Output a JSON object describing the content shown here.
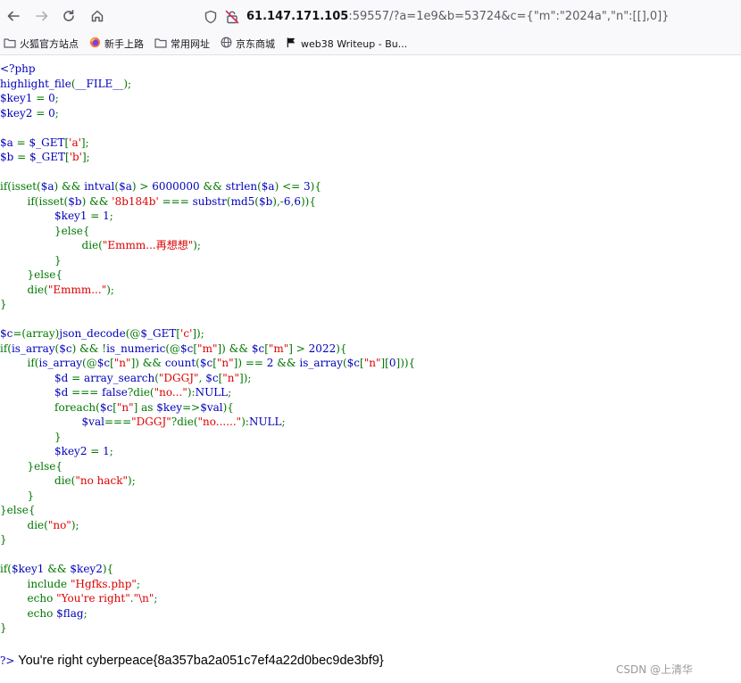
{
  "browser": {
    "url_host": "61.147.171.105",
    "url_rest": ":59557/?a=1e9&b=53724&c={\"m\":\"2024a\",\"n\":[[],0]}",
    "bookmarks": [
      {
        "label": "火狐官方站点",
        "icon": "folder-icon"
      },
      {
        "label": "新手上路",
        "icon": "firefox-icon"
      },
      {
        "label": "常用网址",
        "icon": "folder-icon"
      },
      {
        "label": "京东商城",
        "icon": "globe-icon"
      },
      {
        "label": "web38 Writeup - Bu...",
        "icon": "flag-icon"
      }
    ]
  },
  "code_lines": [
    [
      {
        "c": "df",
        "t": "<?php"
      }
    ],
    [
      {
        "c": "df",
        "t": "highlight_file"
      },
      {
        "c": "kw",
        "t": "("
      },
      {
        "c": "df",
        "t": "__FILE__"
      },
      {
        "c": "kw",
        "t": ");"
      }
    ],
    [
      {
        "c": "df",
        "t": "$key1 "
      },
      {
        "c": "kw",
        "t": "= "
      },
      {
        "c": "df",
        "t": "0"
      },
      {
        "c": "kw",
        "t": ";"
      }
    ],
    [
      {
        "c": "df",
        "t": "$key2 "
      },
      {
        "c": "kw",
        "t": "= "
      },
      {
        "c": "df",
        "t": "0"
      },
      {
        "c": "kw",
        "t": ";"
      }
    ],
    [],
    [
      {
        "c": "df",
        "t": "$a "
      },
      {
        "c": "kw",
        "t": "= "
      },
      {
        "c": "df",
        "t": "$_GET"
      },
      {
        "c": "kw",
        "t": "["
      },
      {
        "c": "st",
        "t": "'a'"
      },
      {
        "c": "kw",
        "t": "];"
      }
    ],
    [
      {
        "c": "df",
        "t": "$b "
      },
      {
        "c": "kw",
        "t": "= "
      },
      {
        "c": "df",
        "t": "$_GET"
      },
      {
        "c": "kw",
        "t": "["
      },
      {
        "c": "st",
        "t": "'b'"
      },
      {
        "c": "kw",
        "t": "];"
      }
    ],
    [],
    [
      {
        "c": "kw",
        "t": "if(isset("
      },
      {
        "c": "df",
        "t": "$a"
      },
      {
        "c": "kw",
        "t": ") && "
      },
      {
        "c": "df",
        "t": "intval"
      },
      {
        "c": "kw",
        "t": "("
      },
      {
        "c": "df",
        "t": "$a"
      },
      {
        "c": "kw",
        "t": ") > "
      },
      {
        "c": "df",
        "t": "6000000 "
      },
      {
        "c": "kw",
        "t": "&& "
      },
      {
        "c": "df",
        "t": "strlen"
      },
      {
        "c": "kw",
        "t": "("
      },
      {
        "c": "df",
        "t": "$a"
      },
      {
        "c": "kw",
        "t": ") <= "
      },
      {
        "c": "df",
        "t": "3"
      },
      {
        "c": "kw",
        "t": "){"
      }
    ],
    [
      {
        "c": "kw",
        "t": "        if(isset("
      },
      {
        "c": "df",
        "t": "$b"
      },
      {
        "c": "kw",
        "t": ") && "
      },
      {
        "c": "st",
        "t": "'8b184b' "
      },
      {
        "c": "kw",
        "t": "=== "
      },
      {
        "c": "df",
        "t": "substr"
      },
      {
        "c": "kw",
        "t": "("
      },
      {
        "c": "df",
        "t": "md5"
      },
      {
        "c": "kw",
        "t": "("
      },
      {
        "c": "df",
        "t": "$b"
      },
      {
        "c": "kw",
        "t": "),-"
      },
      {
        "c": "df",
        "t": "6"
      },
      {
        "c": "kw",
        "t": ","
      },
      {
        "c": "df",
        "t": "6"
      },
      {
        "c": "kw",
        "t": ")){"
      }
    ],
    [
      {
        "c": "df",
        "t": "                $key1 "
      },
      {
        "c": "kw",
        "t": "= "
      },
      {
        "c": "df",
        "t": "1"
      },
      {
        "c": "kw",
        "t": ";"
      }
    ],
    [
      {
        "c": "kw",
        "t": "                }else{"
      }
    ],
    [
      {
        "c": "kw",
        "t": "                        die("
      },
      {
        "c": "st",
        "t": "\"Emmm...再想想\""
      },
      {
        "c": "kw",
        "t": ");"
      }
    ],
    [
      {
        "c": "kw",
        "t": "                }"
      }
    ],
    [
      {
        "c": "kw",
        "t": "        }else{"
      }
    ],
    [
      {
        "c": "kw",
        "t": "        die("
      },
      {
        "c": "st",
        "t": "\"Emmm...\""
      },
      {
        "c": "kw",
        "t": ");"
      }
    ],
    [
      {
        "c": "kw",
        "t": "}"
      }
    ],
    [],
    [
      {
        "c": "df",
        "t": "$c"
      },
      {
        "c": "kw",
        "t": "=(array)"
      },
      {
        "c": "df",
        "t": "json_decode"
      },
      {
        "c": "kw",
        "t": "(@"
      },
      {
        "c": "df",
        "t": "$_GET"
      },
      {
        "c": "kw",
        "t": "["
      },
      {
        "c": "st",
        "t": "'c'"
      },
      {
        "c": "kw",
        "t": "]);"
      }
    ],
    [
      {
        "c": "kw",
        "t": "if("
      },
      {
        "c": "df",
        "t": "is_array"
      },
      {
        "c": "kw",
        "t": "("
      },
      {
        "c": "df",
        "t": "$c"
      },
      {
        "c": "kw",
        "t": ") && !"
      },
      {
        "c": "df",
        "t": "is_numeric"
      },
      {
        "c": "kw",
        "t": "(@"
      },
      {
        "c": "df",
        "t": "$c"
      },
      {
        "c": "kw",
        "t": "["
      },
      {
        "c": "st",
        "t": "\"m\""
      },
      {
        "c": "kw",
        "t": "]) && "
      },
      {
        "c": "df",
        "t": "$c"
      },
      {
        "c": "kw",
        "t": "["
      },
      {
        "c": "st",
        "t": "\"m\""
      },
      {
        "c": "kw",
        "t": "] > "
      },
      {
        "c": "df",
        "t": "2022"
      },
      {
        "c": "kw",
        "t": "){"
      }
    ],
    [
      {
        "c": "kw",
        "t": "        if("
      },
      {
        "c": "df",
        "t": "is_array"
      },
      {
        "c": "kw",
        "t": "(@"
      },
      {
        "c": "df",
        "t": "$c"
      },
      {
        "c": "kw",
        "t": "["
      },
      {
        "c": "st",
        "t": "\"n\""
      },
      {
        "c": "kw",
        "t": "]) && "
      },
      {
        "c": "df",
        "t": "count"
      },
      {
        "c": "kw",
        "t": "("
      },
      {
        "c": "df",
        "t": "$c"
      },
      {
        "c": "kw",
        "t": "["
      },
      {
        "c": "st",
        "t": "\"n\""
      },
      {
        "c": "kw",
        "t": "]) == "
      },
      {
        "c": "df",
        "t": "2 "
      },
      {
        "c": "kw",
        "t": "&& "
      },
      {
        "c": "df",
        "t": "is_array"
      },
      {
        "c": "kw",
        "t": "("
      },
      {
        "c": "df",
        "t": "$c"
      },
      {
        "c": "kw",
        "t": "["
      },
      {
        "c": "st",
        "t": "\"n\""
      },
      {
        "c": "kw",
        "t": "]["
      },
      {
        "c": "df",
        "t": "0"
      },
      {
        "c": "kw",
        "t": "])){"
      }
    ],
    [
      {
        "c": "df",
        "t": "                $d "
      },
      {
        "c": "kw",
        "t": "= "
      },
      {
        "c": "df",
        "t": "array_search"
      },
      {
        "c": "kw",
        "t": "("
      },
      {
        "c": "st",
        "t": "\"DGGJ\""
      },
      {
        "c": "kw",
        "t": ", "
      },
      {
        "c": "df",
        "t": "$c"
      },
      {
        "c": "kw",
        "t": "["
      },
      {
        "c": "st",
        "t": "\"n\""
      },
      {
        "c": "kw",
        "t": "]);"
      }
    ],
    [
      {
        "c": "df",
        "t": "                $d "
      },
      {
        "c": "kw",
        "t": "=== "
      },
      {
        "c": "df",
        "t": "false"
      },
      {
        "c": "kw",
        "t": "?die("
      },
      {
        "c": "st",
        "t": "\"no...\""
      },
      {
        "c": "kw",
        "t": "):"
      },
      {
        "c": "df",
        "t": "NULL"
      },
      {
        "c": "kw",
        "t": ";"
      }
    ],
    [
      {
        "c": "kw",
        "t": "                foreach("
      },
      {
        "c": "df",
        "t": "$c"
      },
      {
        "c": "kw",
        "t": "["
      },
      {
        "c": "st",
        "t": "\"n\""
      },
      {
        "c": "kw",
        "t": "] as "
      },
      {
        "c": "df",
        "t": "$key"
      },
      {
        "c": "kw",
        "t": "=>"
      },
      {
        "c": "df",
        "t": "$val"
      },
      {
        "c": "kw",
        "t": "){"
      }
    ],
    [
      {
        "c": "df",
        "t": "                        $val"
      },
      {
        "c": "kw",
        "t": "==="
      },
      {
        "c": "st",
        "t": "\"DGGJ\""
      },
      {
        "c": "kw",
        "t": "?die("
      },
      {
        "c": "st",
        "t": "\"no......\""
      },
      {
        "c": "kw",
        "t": "):"
      },
      {
        "c": "df",
        "t": "NULL"
      },
      {
        "c": "kw",
        "t": ";"
      }
    ],
    [
      {
        "c": "kw",
        "t": "                }"
      }
    ],
    [
      {
        "c": "df",
        "t": "                $key2 "
      },
      {
        "c": "kw",
        "t": "= "
      },
      {
        "c": "df",
        "t": "1"
      },
      {
        "c": "kw",
        "t": ";"
      }
    ],
    [
      {
        "c": "kw",
        "t": "        }else{"
      }
    ],
    [
      {
        "c": "kw",
        "t": "                die("
      },
      {
        "c": "st",
        "t": "\"no hack\""
      },
      {
        "c": "kw",
        "t": ");"
      }
    ],
    [
      {
        "c": "kw",
        "t": "        }"
      }
    ],
    [
      {
        "c": "kw",
        "t": "}else{"
      }
    ],
    [
      {
        "c": "kw",
        "t": "        die("
      },
      {
        "c": "st",
        "t": "\"no\""
      },
      {
        "c": "kw",
        "t": ");"
      }
    ],
    [
      {
        "c": "kw",
        "t": "}"
      }
    ],
    [],
    [
      {
        "c": "kw",
        "t": "if("
      },
      {
        "c": "df",
        "t": "$key1 "
      },
      {
        "c": "kw",
        "t": "&& "
      },
      {
        "c": "df",
        "t": "$key2"
      },
      {
        "c": "kw",
        "t": "){"
      }
    ],
    [
      {
        "c": "kw",
        "t": "        include "
      },
      {
        "c": "st",
        "t": "\"Hgfks.php\""
      },
      {
        "c": "kw",
        "t": ";"
      }
    ],
    [
      {
        "c": "kw",
        "t": "        echo "
      },
      {
        "c": "st",
        "t": "\"You're right\""
      },
      {
        "c": "kw",
        "t": "."
      },
      {
        "c": "st",
        "t": "\"\\n\""
      },
      {
        "c": "kw",
        "t": ";"
      }
    ],
    [
      {
        "c": "kw",
        "t": "        echo "
      },
      {
        "c": "df",
        "t": "$flag"
      },
      {
        "c": "kw",
        "t": ";"
      }
    ],
    [
      {
        "c": "kw",
        "t": "}"
      }
    ]
  ],
  "output": {
    "php_close": "?>",
    "text": " You're right cyberpeace{8a357ba2a051c7ef4a22d0bec9de3bf9}"
  },
  "watermark": "CSDN @上清华"
}
